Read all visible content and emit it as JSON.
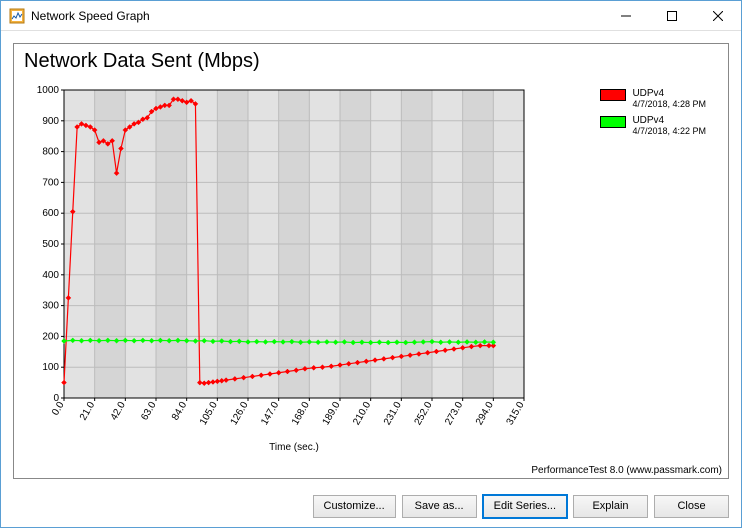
{
  "window": {
    "title": "Network Speed Graph",
    "minimize_tooltip": "Minimize",
    "maximize_tooltip": "Maximize",
    "close_tooltip": "Close"
  },
  "chart": {
    "title": "Network Data Sent (Mbps)",
    "xlabel": "Time (sec.)",
    "footer": "PerformanceTest 8.0 (www.passmark.com)"
  },
  "legend": {
    "items": [
      {
        "name": "UDPv4",
        "sub": "4/7/2018, 4:28 PM",
        "color": "#ff0000"
      },
      {
        "name": "UDPv4",
        "sub": "4/7/2018, 4:22 PM",
        "color": "#00ff00"
      }
    ]
  },
  "buttons": {
    "customize": "Customize...",
    "save_as": "Save as...",
    "edit_series": "Edit Series...",
    "explain": "Explain",
    "close": "Close"
  },
  "chart_data": {
    "type": "line",
    "xlabel": "Time (sec.)",
    "ylabel": "",
    "title": "Network Data Sent (Mbps)",
    "xlim": [
      0,
      315
    ],
    "ylim": [
      0,
      1000
    ],
    "xticks": [
      0.0,
      21.0,
      42.0,
      63.0,
      84.0,
      105.0,
      126.0,
      147.0,
      168.0,
      189.0,
      210.0,
      231.0,
      252.0,
      273.0,
      294.0,
      315.0
    ],
    "yticks": [
      0,
      100,
      200,
      300,
      400,
      500,
      600,
      700,
      800,
      900,
      1000
    ],
    "series": [
      {
        "name": "UDPv4 4/7/2018, 4:28 PM",
        "color": "#ff0000",
        "x": [
          0,
          3,
          6,
          9,
          12,
          15,
          18,
          21,
          24,
          27,
          30,
          33,
          36,
          39,
          42,
          45,
          48,
          51,
          54,
          57,
          60,
          63,
          66,
          69,
          72,
          75,
          78,
          81,
          84,
          87,
          90,
          93,
          96,
          99,
          102,
          105,
          108,
          111,
          117,
          123,
          129,
          135,
          141,
          147,
          153,
          159,
          165,
          171,
          177,
          183,
          189,
          195,
          201,
          207,
          213,
          219,
          225,
          231,
          237,
          243,
          249,
          255,
          261,
          267,
          273,
          279,
          285,
          291,
          294
        ],
        "values": [
          50,
          325,
          605,
          880,
          890,
          885,
          880,
          870,
          830,
          835,
          825,
          835,
          730,
          810,
          870,
          880,
          890,
          895,
          905,
          910,
          930,
          940,
          945,
          950,
          950,
          970,
          970,
          965,
          960,
          965,
          955,
          50,
          48,
          50,
          52,
          54,
          56,
          58,
          62,
          66,
          70,
          74,
          78,
          82,
          86,
          90,
          95,
          98,
          100,
          103,
          107,
          111,
          115,
          119,
          123,
          127,
          131,
          135,
          139,
          143,
          147,
          151,
          155,
          159,
          163,
          167,
          170,
          170,
          170
        ]
      },
      {
        "name": "UDPv4 4/7/2018, 4:22 PM",
        "color": "#00ff00",
        "x": [
          0,
          6,
          12,
          18,
          24,
          30,
          36,
          42,
          48,
          54,
          60,
          66,
          72,
          78,
          84,
          90,
          96,
          102,
          108,
          114,
          120,
          126,
          132,
          138,
          144,
          150,
          156,
          162,
          168,
          174,
          180,
          186,
          192,
          198,
          204,
          210,
          216,
          222,
          228,
          234,
          240,
          246,
          252,
          258,
          264,
          270,
          276,
          282,
          288,
          294
        ],
        "values": [
          185,
          187,
          186,
          187,
          186,
          187,
          186,
          187,
          186,
          187,
          186,
          187,
          186,
          187,
          186,
          185,
          186,
          184,
          185,
          183,
          184,
          182,
          183,
          182,
          183,
          182,
          183,
          181,
          182,
          181,
          182,
          181,
          182,
          180,
          181,
          180,
          181,
          180,
          181,
          180,
          181,
          182,
          183,
          181,
          182,
          181,
          182,
          181,
          182,
          181
        ]
      }
    ]
  }
}
